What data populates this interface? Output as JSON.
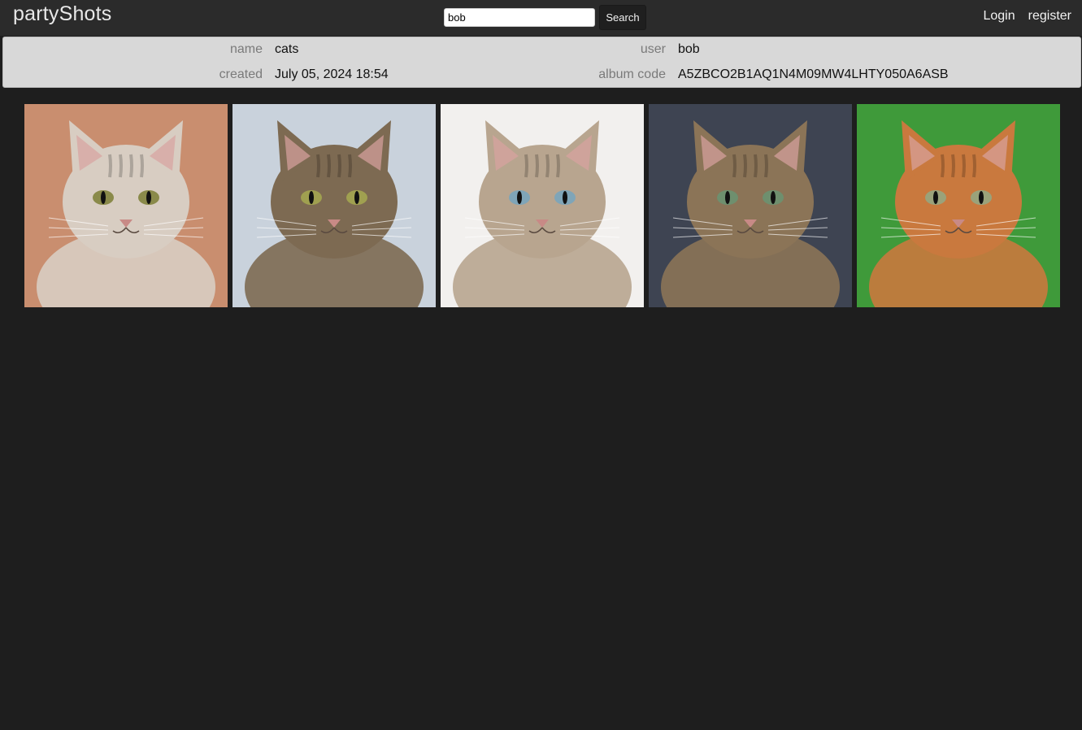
{
  "header": {
    "brand": "partyShots",
    "search": {
      "value": "bob",
      "button_label": "Search"
    },
    "nav": {
      "login": "Login",
      "register": "register"
    }
  },
  "album": {
    "name_label": "name",
    "name": "cats",
    "user_label": "user",
    "user": "bob",
    "created_label": "created",
    "created": "July 05, 2024 18:54",
    "code_label": "album code",
    "code": "A5ZBCO2B1AQ1N4M09MW4LHTY050A6ASB"
  },
  "photos": [
    {
      "subject": "cream tabby cat close-up",
      "background": "#c98e6f",
      "fur": "#d8cdc2",
      "eye": "#8a8a4a"
    },
    {
      "subject": "tabby cat sitting on rock",
      "background": "#c9d2dc",
      "fur": "#7d6a52",
      "eye": "#a0a050"
    },
    {
      "subject": "tabby point cat looking down",
      "background": "#f2f0ee",
      "fur": "#b8a58f",
      "eye": "#7fa5b8"
    },
    {
      "subject": "tabby cat looking up",
      "background": "#3e4452",
      "fur": "#8b7457",
      "eye": "#6e8f6e"
    },
    {
      "subject": "orange cat on green",
      "background": "#3f9a3a",
      "fur": "#c9793e",
      "eye": "#9aa27a"
    }
  ]
}
